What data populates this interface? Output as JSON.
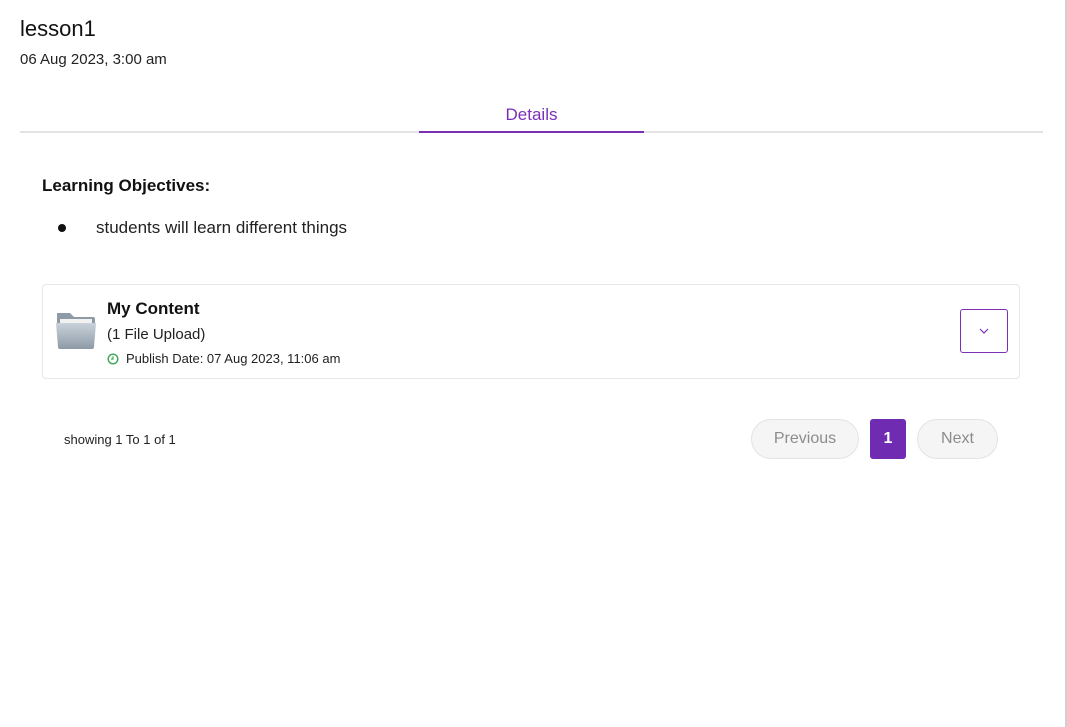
{
  "lesson": {
    "title": "lesson1",
    "date": "06 Aug 2023, 3:00 am"
  },
  "tabs": [
    {
      "label": "Details",
      "active": true
    }
  ],
  "objectives": {
    "heading": "Learning Objectives:",
    "items": [
      "students will learn different things"
    ]
  },
  "content_card": {
    "icon": "folder-icon",
    "title": "My Content",
    "subtitle": "(1 File Upload)",
    "publish_icon": "clock-icon",
    "publish_text": "Publish Date: 07 Aug 2023, 11:06 am",
    "expand_icon": "chevron-down-icon"
  },
  "pagination": {
    "showing": "showing 1 To 1 of 1",
    "previous_label": "Previous",
    "current_page": "1",
    "next_label": "Next"
  },
  "colors": {
    "accent": "#7b2fb5",
    "active_page": "#6f2cb3",
    "publish_icon": "#3aa655"
  }
}
